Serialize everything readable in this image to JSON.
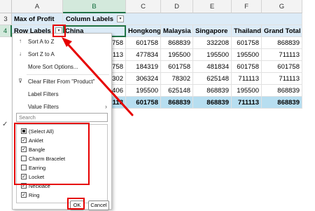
{
  "columns": [
    "A",
    "B",
    "C",
    "D",
    "E",
    "F",
    "G"
  ],
  "rows": [
    "3",
    "4"
  ],
  "pivot": {
    "value_field": "Max of Profit",
    "column_labels": "Column Labels",
    "row_labels": "Row Labels",
    "headers": [
      "China",
      "Hongkong",
      "Malaysia",
      "Singapore",
      "Thailand",
      "Grand Total"
    ],
    "data_rows": [
      [
        "758",
        "601758",
        "868839",
        "332208",
        "601758",
        "868839"
      ],
      [
        "113",
        "477834",
        "195500",
        "195500",
        "195500",
        "711113"
      ],
      [
        "758",
        "184319",
        "601758",
        "481834",
        "601758",
        "601758"
      ],
      [
        "302",
        "306324",
        "78302",
        "625148",
        "711113",
        "711113"
      ],
      [
        "406",
        "195500",
        "625148",
        "868839",
        "195500",
        "868839"
      ]
    ],
    "total_row": [
      "113",
      "601758",
      "868839",
      "868839",
      "711113",
      "868839"
    ]
  },
  "filter_menu": {
    "items": [
      {
        "label": "Sort A to Z",
        "icon": "sort-az-icon"
      },
      {
        "label": "Sort Z to A",
        "icon": "sort-za-icon"
      },
      {
        "label": "More Sort Options...",
        "icon": ""
      },
      {
        "label": "Clear Filter From \"Product\"",
        "icon": "clear-filter-icon"
      },
      {
        "label": "Label Filters",
        "icon": ""
      },
      {
        "label": "Value Filters",
        "icon": ""
      }
    ],
    "search_placeholder": "Search",
    "list": [
      {
        "label": "(Select All)",
        "state": "indeterminate"
      },
      {
        "label": "Anklet",
        "state": "checked"
      },
      {
        "label": "Bangle",
        "state": "checked"
      },
      {
        "label": "Charm Bracelet",
        "state": "unchecked"
      },
      {
        "label": "Earring",
        "state": "unchecked"
      },
      {
        "label": "Locket",
        "state": "checked"
      },
      {
        "label": "Necklace",
        "state": "checked"
      },
      {
        "label": "Ring",
        "state": "checked"
      }
    ],
    "ok_label": "OK",
    "cancel_label": "Cancel"
  },
  "colors": {
    "header_band": "#dcebf7",
    "total_band": "#b7def0",
    "highlight": "#e60000",
    "excel_green": "#217346"
  }
}
